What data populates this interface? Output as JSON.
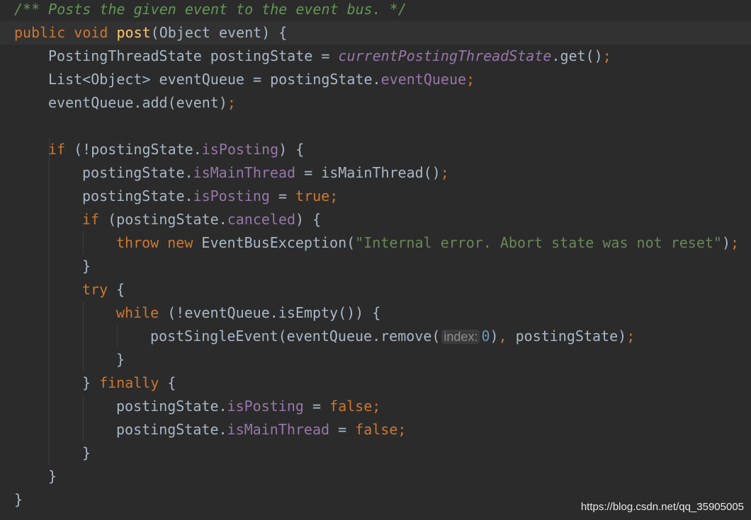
{
  "editor": {
    "theme": {
      "background": "#2b2b2b",
      "current_line": "#323232",
      "keyword": "#cc7832",
      "comment": "#629755",
      "field": "#9876aa",
      "string": "#6a8759",
      "number": "#6897bb",
      "method_declaration": "#ffc66d",
      "plain": "#a9b7c6"
    },
    "lines": [
      {
        "indent": 0,
        "tokens": [
          {
            "t": "comment",
            "v": "/** Posts the given event to the event bus. */"
          }
        ]
      },
      {
        "indent": 0,
        "current": true,
        "tokens": [
          {
            "t": "keyword",
            "v": "public void "
          },
          {
            "t": "method-decl caret-match",
            "v": "post"
          },
          {
            "t": "plain",
            "v": "(Object event) {"
          }
        ]
      },
      {
        "indent": 1,
        "tokens": [
          {
            "t": "plain",
            "v": "PostingThreadState postingState = "
          },
          {
            "t": "static",
            "v": "currentPostingThreadState"
          },
          {
            "t": "plain",
            "v": ".get()"
          },
          {
            "t": "punct",
            "v": ";"
          }
        ]
      },
      {
        "indent": 1,
        "tokens": [
          {
            "t": "plain",
            "v": "List<Object> eventQueue = postingState."
          },
          {
            "t": "field",
            "v": "eventQueue"
          },
          {
            "t": "punct",
            "v": ";"
          }
        ]
      },
      {
        "indent": 1,
        "tokens": [
          {
            "t": "plain",
            "v": "eventQueue.add(event)"
          },
          {
            "t": "punct",
            "v": ";"
          }
        ]
      },
      {
        "indent": 0,
        "tokens": []
      },
      {
        "indent": 1,
        "tokens": [
          {
            "t": "keyword",
            "v": "if "
          },
          {
            "t": "plain",
            "v": "(!postingState."
          },
          {
            "t": "field",
            "v": "isPosting"
          },
          {
            "t": "plain",
            "v": ") {"
          }
        ]
      },
      {
        "indent": 2,
        "tokens": [
          {
            "t": "plain",
            "v": "postingState."
          },
          {
            "t": "field",
            "v": "isMainThread"
          },
          {
            "t": "plain",
            "v": " = isMainThread()"
          },
          {
            "t": "punct",
            "v": ";"
          }
        ]
      },
      {
        "indent": 2,
        "tokens": [
          {
            "t": "plain",
            "v": "postingState."
          },
          {
            "t": "field",
            "v": "isPosting"
          },
          {
            "t": "plain",
            "v": " = "
          },
          {
            "t": "keyword",
            "v": "true"
          },
          {
            "t": "punct",
            "v": ";"
          }
        ]
      },
      {
        "indent": 2,
        "tokens": [
          {
            "t": "keyword",
            "v": "if "
          },
          {
            "t": "plain",
            "v": "(postingState."
          },
          {
            "t": "field",
            "v": "canceled"
          },
          {
            "t": "plain",
            "v": ") {"
          }
        ]
      },
      {
        "indent": 3,
        "tokens": [
          {
            "t": "keyword",
            "v": "throw new "
          },
          {
            "t": "plain",
            "v": "EventBusException("
          },
          {
            "t": "string",
            "v": "\"Internal error. Abort state was not reset\""
          },
          {
            "t": "plain",
            "v": ")"
          },
          {
            "t": "punct",
            "v": ";"
          }
        ]
      },
      {
        "indent": 2,
        "tokens": [
          {
            "t": "plain",
            "v": "}"
          }
        ]
      },
      {
        "indent": 2,
        "tokens": [
          {
            "t": "keyword",
            "v": "try "
          },
          {
            "t": "plain",
            "v": "{"
          }
        ]
      },
      {
        "indent": 3,
        "tokens": [
          {
            "t": "keyword",
            "v": "while "
          },
          {
            "t": "plain",
            "v": "(!eventQueue.isEmpty()) {"
          }
        ]
      },
      {
        "indent": 4,
        "tokens": [
          {
            "t": "plain",
            "v": "postSingleEvent(eventQueue.remove("
          },
          {
            "t": "hint",
            "v": "index:"
          },
          {
            "t": "number",
            "v": "0"
          },
          {
            "t": "plain",
            "v": ")"
          },
          {
            "t": "punct",
            "v": ", "
          },
          {
            "t": "plain",
            "v": "postingState)"
          },
          {
            "t": "punct",
            "v": ";"
          }
        ]
      },
      {
        "indent": 3,
        "tokens": [
          {
            "t": "plain",
            "v": "}"
          }
        ]
      },
      {
        "indent": 2,
        "tokens": [
          {
            "t": "plain",
            "v": "} "
          },
          {
            "t": "keyword",
            "v": "finally "
          },
          {
            "t": "plain",
            "v": "{"
          }
        ]
      },
      {
        "indent": 3,
        "tokens": [
          {
            "t": "plain",
            "v": "postingState."
          },
          {
            "t": "field",
            "v": "isPosting"
          },
          {
            "t": "plain",
            "v": " = "
          },
          {
            "t": "keyword",
            "v": "false"
          },
          {
            "t": "punct",
            "v": ";"
          }
        ]
      },
      {
        "indent": 3,
        "tokens": [
          {
            "t": "plain",
            "v": "postingState."
          },
          {
            "t": "field",
            "v": "isMainThread"
          },
          {
            "t": "plain",
            "v": " = "
          },
          {
            "t": "keyword",
            "v": "false"
          },
          {
            "t": "punct",
            "v": ";"
          }
        ]
      },
      {
        "indent": 2,
        "tokens": [
          {
            "t": "plain",
            "v": "}"
          }
        ]
      },
      {
        "indent": 1,
        "tokens": [
          {
            "t": "plain",
            "v": "}"
          }
        ]
      },
      {
        "indent": 0,
        "tokens": [
          {
            "t": "plain",
            "v": "}"
          }
        ]
      }
    ]
  },
  "watermark": "https://blog.csdn.net/qq_35905005"
}
